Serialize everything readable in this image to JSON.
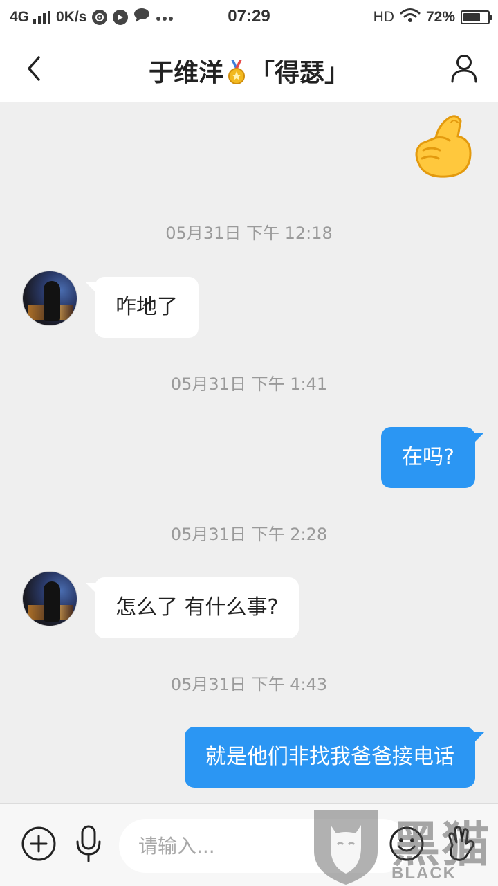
{
  "status_bar": {
    "network": "4G",
    "speed": "0K/s",
    "time": "07:29",
    "hd": "HD",
    "battery_pct": "72%",
    "battery_level": 0.72,
    "icons": [
      "signal-icon",
      "vpn-icon",
      "media-icon",
      "chat-notify-icon",
      "more-icon",
      "wifi-icon",
      "battery-icon"
    ]
  },
  "header": {
    "title_name": "于维洋",
    "title_tag": "「得瑟」",
    "back_icon": "chevron-left-icon",
    "profile_icon": "person-icon",
    "medal_icon": "medal-icon"
  },
  "messages": [
    {
      "type": "sticker",
      "side": "out",
      "icon": "finger-heart-emoji"
    },
    {
      "type": "time",
      "text": "05月31日 下午 12:18"
    },
    {
      "type": "text",
      "side": "in",
      "text": "咋地了"
    },
    {
      "type": "time",
      "text": "05月31日 下午 1:41"
    },
    {
      "type": "text",
      "side": "out",
      "text": "在吗?"
    },
    {
      "type": "time",
      "text": "05月31日 下午 2:28"
    },
    {
      "type": "text",
      "side": "in",
      "text": "怎么了 有什么事?"
    },
    {
      "type": "time",
      "text": "05月31日 下午 4:43"
    },
    {
      "type": "text",
      "side": "out",
      "text": "就是他们非找我爸爸接电话"
    }
  ],
  "input_bar": {
    "placeholder": "请输入...",
    "value": "",
    "icons": [
      "plus-circle-icon",
      "microphone-icon",
      "emoji-icon",
      "hand-icon"
    ]
  },
  "watermark": {
    "text_cn": "黑猫",
    "text_en": "BLACK CAT"
  },
  "colors": {
    "accent": "#2b96f3",
    "background": "#efefef",
    "incoming_bubble": "#ffffff",
    "timestamp": "#9a9a9a"
  }
}
